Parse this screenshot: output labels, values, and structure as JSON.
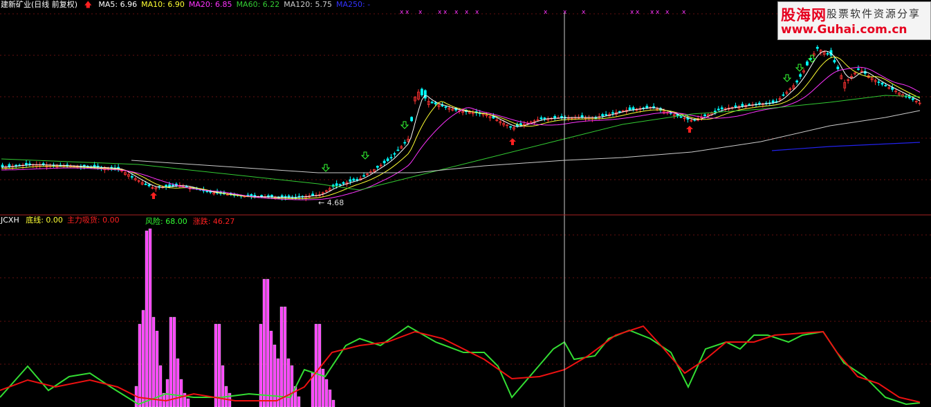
{
  "header": {
    "stock_title": "建新矿业(日线 前复权)",
    "ma_items": [
      {
        "label": "MA5: 6.96",
        "color": "#ffffff"
      },
      {
        "label": "MA10: 6.90",
        "color": "#ffff33"
      },
      {
        "label": "MA20: 6.85",
        "color": "#ff33ff"
      },
      {
        "label": "MA60: 6.22",
        "color": "#33cc33"
      },
      {
        "label": "MA120: 5.75",
        "color": "#cccccc"
      },
      {
        "label": "MA250: -",
        "color": "#3333ff"
      }
    ]
  },
  "indicator": {
    "name": "JCXH",
    "items": [
      {
        "label": "底线: 0.00",
        "color": "#ffff33"
      },
      {
        "label": "主力吸货: 0.00",
        "color": "#ff2020"
      }
    ],
    "items_right": [
      {
        "label": "风险: 68.00",
        "color": "#33ff33"
      },
      {
        "label": "涨跌: 46.27",
        "color": "#ff2020"
      }
    ]
  },
  "price_marker": "4.68",
  "watermark": {
    "brand": "股海网",
    "slogan": "股票软件资源分享",
    "url": "www.Guhai.com.cn"
  },
  "colors": {
    "up_candle": "#ff3333",
    "down_candle": "#00ffff",
    "ma5": "#ffffff",
    "ma10": "#ffff33",
    "ma20": "#ff33ff",
    "ma60": "#33cc33",
    "ma120": "#cccccc",
    "ma250": "#2222ee",
    "risk_line": "#33dd33",
    "change_line": "#ee1111",
    "absorb_bar": "#ff44ff",
    "grid": "#661111",
    "cursor": "#cccccc"
  },
  "chart_data": {
    "type": "line",
    "title": "",
    "panels": [
      {
        "name": "price",
        "series": [
          {
            "name": "MA5",
            "values": [
              6.96
            ]
          },
          {
            "name": "MA10",
            "values": [
              6.9
            ]
          },
          {
            "name": "MA20",
            "values": [
              6.85
            ]
          },
          {
            "name": "MA60",
            "values": [
              6.22
            ]
          },
          {
            "name": "MA120",
            "values": [
              5.75
            ]
          }
        ],
        "low_marker": 4.68
      },
      {
        "name": "JCXH",
        "series": [
          {
            "name": "风险",
            "values": [
              68.0
            ]
          },
          {
            "name": "涨跌",
            "values": [
              46.27
            ]
          },
          {
            "name": "底线",
            "values": [
              0.0
            ]
          },
          {
            "name": "主力吸货",
            "values": [
              0.0
            ]
          }
        ]
      }
    ]
  }
}
